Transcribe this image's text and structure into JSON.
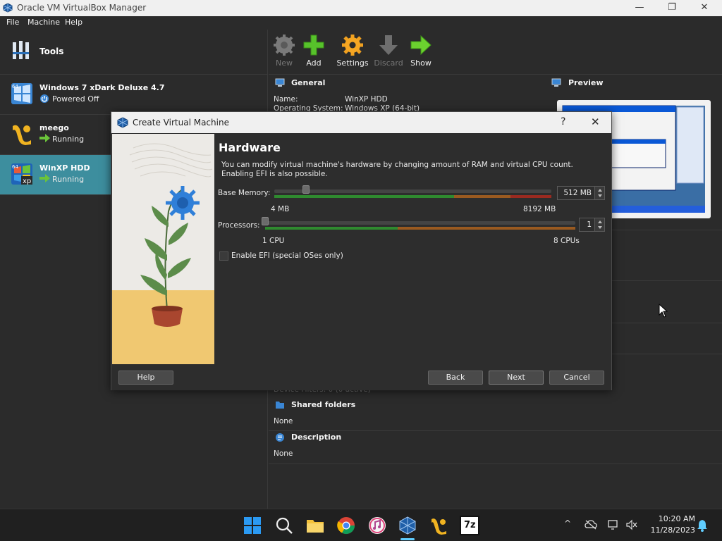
{
  "window": {
    "title": "Oracle VM VirtualBox Manager",
    "minimize": "—",
    "restore": "❐",
    "close": "✕"
  },
  "menu": [
    {
      "label": "File",
      "mnemonic": "F"
    },
    {
      "label": "Machine",
      "mnemonic": "M"
    },
    {
      "label": "Help",
      "mnemonic": "H"
    }
  ],
  "tools": {
    "label": "Tools"
  },
  "vms": [
    {
      "name": "Windows 7 xDark Deluxe 4.7",
      "state": "Powered Off",
      "badge": "64"
    },
    {
      "name": "meego",
      "state": "Running",
      "badge": ""
    },
    {
      "name": "WinXP HDD",
      "state": "Running",
      "badge": "64"
    }
  ],
  "toolbar": {
    "new": "New",
    "add": "Add",
    "settings": "Settings",
    "discard": "Discard",
    "show": "Show"
  },
  "details": {
    "general_title": "General",
    "name_label": "Name:",
    "name_value": "WinXP HDD",
    "os_label": "Operating System:",
    "os_value": "Windows XP (64-bit)",
    "preview_title": "Preview",
    "shared_title": "Shared folders",
    "shared_value": "None",
    "description_title": "Description",
    "description_value": "None",
    "obscured_text": "Device Filters:   0 (0 active)"
  },
  "dialog": {
    "title": "Create Virtual Machine",
    "help_glyph": "?",
    "close_glyph": "✕",
    "heading": "Hardware",
    "desc_line1": "You can modify virtual machine's hardware by changing amount of RAM and virtual CPU count.",
    "desc_line2": "Enabling EFI is also possible.",
    "memory": {
      "label": "Base Memory:",
      "min_label": "4 MB",
      "max_label": "8192 MB",
      "value": "512 MB",
      "value_mb": 512,
      "min_mb": 4,
      "max_mb": 8192
    },
    "processors": {
      "label": "Processors:",
      "min_label": "1 CPU",
      "max_label": "8 CPUs",
      "value": "1",
      "value_count": 1,
      "min": 1,
      "max": 8
    },
    "efi": {
      "label": "Enable EFI (special OSes only)",
      "checked": false
    },
    "buttons": {
      "help": "Help",
      "back": "Back",
      "next": "Next",
      "cancel": "Cancel"
    }
  },
  "taskbar": {
    "clock_time": "10:20 AM",
    "clock_date": "11/28/2023",
    "apps": [
      "start-icon",
      "search-icon",
      "file-explorer-icon",
      "chrome-icon",
      "itunes-icon",
      "virtualbox-icon",
      "meego-icon",
      "7zip-icon"
    ],
    "sevenzip_label": "7z",
    "tray_chevron": "^"
  },
  "colors": {
    "selected_row": "#3d8e9e",
    "running_green": "#6bc43a",
    "accent_blue": "#0067c0"
  }
}
